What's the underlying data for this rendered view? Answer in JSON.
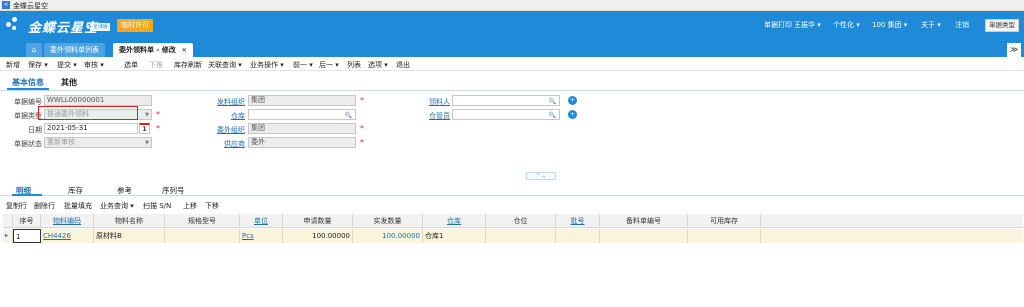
{
  "app": {
    "window_title": "金蝶云星空"
  },
  "header": {
    "logo": "金蝶云星空",
    "logo_badge": "全球版",
    "trial_label": "临时许可",
    "menu": [
      {
        "label": "单据打印"
      },
      {
        "label": "王振华 ▾"
      },
      {
        "label": "个性化 ▾"
      },
      {
        "label": "100 集团 ▾"
      },
      {
        "label": "关于 ▾"
      },
      {
        "label": "注销"
      }
    ],
    "doc_type_button": "单据类型"
  },
  "tabs": [
    {
      "label": "⌂"
    },
    {
      "label": "委外领料单列表"
    },
    {
      "label": "委外领料单 - 修改"
    }
  ],
  "collapse_icon": "≫",
  "toolbar": [
    {
      "label": "新增"
    },
    {
      "label": "保存 ▾"
    },
    {
      "label": "提交 ▾"
    },
    {
      "label": "审核 ▾"
    },
    {
      "label": "选单"
    },
    {
      "label": "下推"
    },
    {
      "label": "库存刷新"
    },
    {
      "label": "关联查询 ▾"
    },
    {
      "label": "业务操作 ▾"
    },
    {
      "label": "前一 ▾"
    },
    {
      "label": "后一 ▾"
    },
    {
      "label": "列表"
    },
    {
      "label": "选项 ▾"
    },
    {
      "label": "退出"
    }
  ],
  "section_tabs": [
    {
      "label": "基本信息"
    },
    {
      "label": "其他"
    }
  ],
  "form": {
    "bill_no": {
      "label": "单据编号",
      "value": "WWLL00000001"
    },
    "bill_type": {
      "label": "单据类型",
      "value": "普通委外领料"
    },
    "date": {
      "label": "日期",
      "value": "2021-05-31",
      "cal_icon": "1"
    },
    "bill_status": {
      "label": "单据状态",
      "value": "重新审核"
    },
    "issue_org": {
      "label": "发料组织",
      "value": "集团"
    },
    "warehouse": {
      "label": "仓库",
      "value": ""
    },
    "outsource_org": {
      "label": "委外组织",
      "value": "集团"
    },
    "supplier": {
      "label": "供应商",
      "value": "委外"
    },
    "picker": {
      "label": "领料人",
      "value": ""
    },
    "stock_keeper": {
      "label": "仓管员",
      "value": ""
    },
    "required_mark": "*",
    "add_icon": "+",
    "search_icon": "🔍",
    "dropdown_icon": "▼"
  },
  "splitter_label": "⌃ ⌄",
  "detail_tabs": [
    {
      "label": "明细"
    },
    {
      "label": "库存"
    },
    {
      "label": "参考"
    },
    {
      "label": "序列号"
    }
  ],
  "grid_toolbar": [
    {
      "label": "复制行"
    },
    {
      "label": "删除行"
    },
    {
      "label": "批量填充"
    },
    {
      "label": "业务查询 ▾"
    },
    {
      "label": "扫描 S/N"
    },
    {
      "label": "上移"
    },
    {
      "label": "下移"
    }
  ],
  "grid": {
    "headers": [
      "序号",
      "物料编码",
      "物料名称",
      "规格型号",
      "单位",
      "申请数量",
      "实发数量",
      "仓库",
      "仓位",
      "批号",
      "备料单编号",
      "可用库存"
    ],
    "rows": [
      {
        "seq": "1",
        "material_code": "CH4426",
        "material_name": "原材料B",
        "spec": "",
        "unit": "Pcs",
        "apply_qty": "100.00000",
        "actual_qty": "100.00000",
        "warehouse": "仓库1",
        "location": "",
        "batch": "",
        "prep_no": "",
        "available": ""
      }
    ],
    "row_marker": "▸"
  },
  "colors": {
    "brand_blue": "#1f8ad8",
    "trial_orange": "#f5a623",
    "required_red": "#e02020",
    "row_highlight": "#fbf4dc"
  }
}
